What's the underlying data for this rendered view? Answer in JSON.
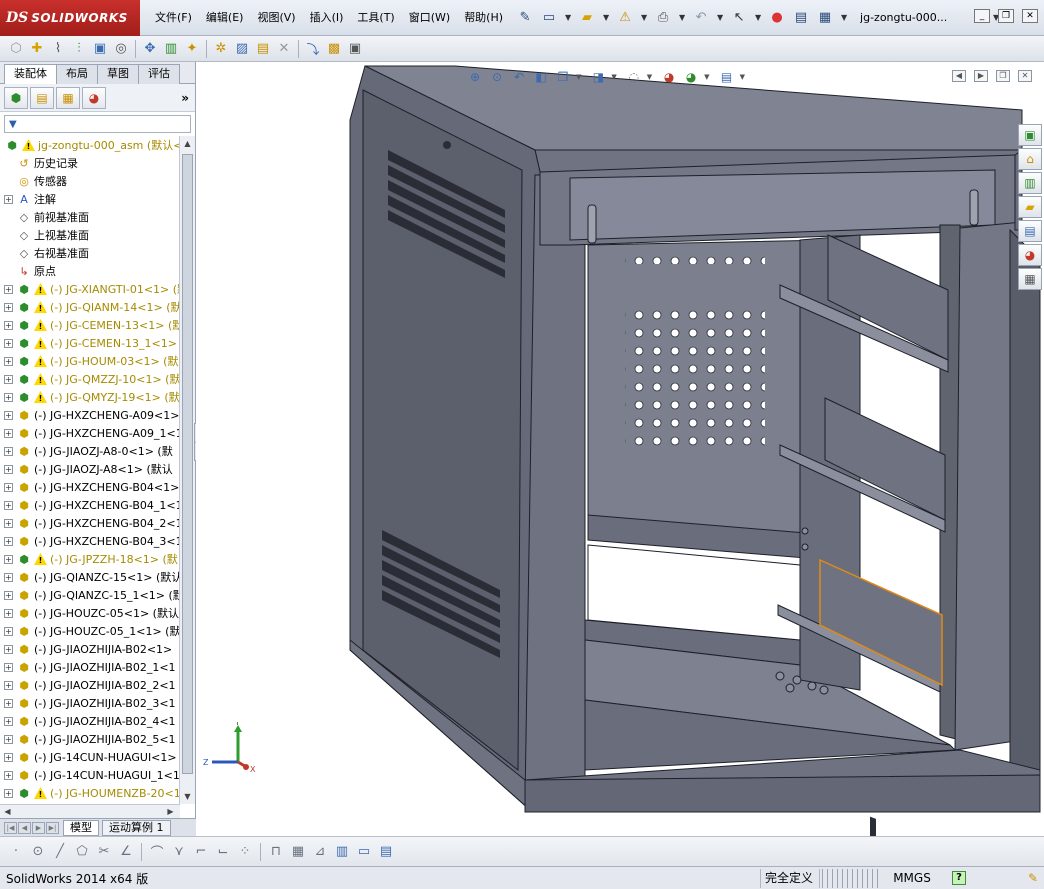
{
  "app": {
    "logo_ds": "DS",
    "logo_name": "SOLIDWORKS",
    "doc_title": "jg-zongtu-000...",
    "help_label": "?"
  },
  "menu": [
    {
      "label": "文件(F)"
    },
    {
      "label": "编辑(E)"
    },
    {
      "label": "视图(V)"
    },
    {
      "label": "插入(I)"
    },
    {
      "label": "工具(T)"
    },
    {
      "label": "窗口(W)"
    },
    {
      "label": "帮助(H)"
    }
  ],
  "cm_tabs": [
    {
      "label": "装配体",
      "active": true
    },
    {
      "label": "布局"
    },
    {
      "label": "草图"
    },
    {
      "label": "评估"
    }
  ],
  "tree": {
    "root": "jg-zongtu-000_asm (默认<",
    "fixed": [
      {
        "label": "历史记录",
        "icon": "history-icon",
        "expand": false
      },
      {
        "label": "传感器",
        "icon": "sensor-icon",
        "expand": false
      },
      {
        "label": "注解",
        "icon": "annotation-icon",
        "expand": true
      },
      {
        "label": "前视基准面",
        "icon": "plane-icon",
        "expand": false
      },
      {
        "label": "上视基准面",
        "icon": "plane-icon",
        "expand": false
      },
      {
        "label": "右视基准面",
        "icon": "plane-icon",
        "expand": false
      },
      {
        "label": "原点",
        "icon": "origin-icon",
        "expand": false
      }
    ],
    "components": [
      {
        "label": "(-) JG-XIANGTI-01<1> (默",
        "warn": true
      },
      {
        "label": "(-) JG-QIANM-14<1> (默",
        "warn": true
      },
      {
        "label": "(-) JG-CEMEN-13<1> (默",
        "warn": true
      },
      {
        "label": "(-) JG-CEMEN-13_1<1>",
        "warn": true
      },
      {
        "label": "(-) JG-HOUM-03<1> (默认",
        "warn": true
      },
      {
        "label": "(-) JG-QMZZJ-10<1> (默",
        "warn": true
      },
      {
        "label": "(-) JG-QMYZJ-19<1> (默",
        "warn": true
      },
      {
        "label": "(-) JG-HXZCHENG-A09<1> (",
        "warn": false
      },
      {
        "label": "(-) JG-HXZCHENG-A09_1<1",
        "warn": false
      },
      {
        "label": "(-) JG-JIAOZJ-A8-0<1> (默",
        "warn": false
      },
      {
        "label": "(-) JG-JIAOZJ-A8<1> (默认",
        "warn": false
      },
      {
        "label": "(-) JG-HXZCHENG-B04<1> (",
        "warn": false
      },
      {
        "label": "(-) JG-HXZCHENG-B04_1<1",
        "warn": false
      },
      {
        "label": "(-) JG-HXZCHENG-B04_2<1",
        "warn": false
      },
      {
        "label": "(-) JG-HXZCHENG-B04_3<1",
        "warn": false
      },
      {
        "label": "(-) JG-JPZZH-18<1> (默",
        "warn": true
      },
      {
        "label": "(-) JG-QIANZC-15<1> (默认",
        "warn": false
      },
      {
        "label": "(-) JG-QIANZC-15_1<1> (默",
        "warn": false
      },
      {
        "label": "(-) JG-HOUZC-05<1> (默认",
        "warn": false
      },
      {
        "label": "(-) JG-HOUZC-05_1<1> (默",
        "warn": false
      },
      {
        "label": "(-) JG-JIAOZHIJIA-B02<1>",
        "warn": false
      },
      {
        "label": "(-) JG-JIAOZHIJIA-B02_1<1",
        "warn": false
      },
      {
        "label": "(-) JG-JIAOZHIJIA-B02_2<1",
        "warn": false
      },
      {
        "label": "(-) JG-JIAOZHIJIA-B02_3<1",
        "warn": false
      },
      {
        "label": "(-) JG-JIAOZHIJIA-B02_4<1",
        "warn": false
      },
      {
        "label": "(-) JG-JIAOZHIJIA-B02_5<1",
        "warn": false
      },
      {
        "label": "(-) JG-14CUN-HUAGUI<1> (",
        "warn": false
      },
      {
        "label": "(-) JG-14CUN-HUAGUI_1<1",
        "warn": false
      },
      {
        "label": "(-) JG-HOUMENZB-20<1",
        "warn": true
      }
    ]
  },
  "bottom_tabs": [
    {
      "label": "模型",
      "active": true
    },
    {
      "label": "运动算例 1",
      "active": false
    }
  ],
  "triad": {
    "x": "X",
    "y": "Y",
    "z": "Z"
  },
  "status": {
    "app_version": "SolidWorks 2014 x64 版",
    "definition": "完全定义",
    "units": "MMGS",
    "help_icon": "?"
  }
}
